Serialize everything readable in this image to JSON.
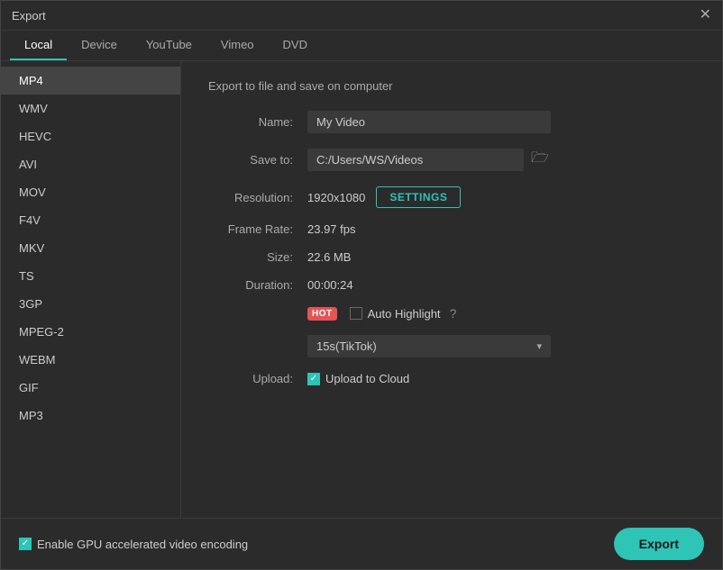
{
  "window": {
    "title": "Export"
  },
  "tabs": [
    {
      "label": "Local",
      "active": true
    },
    {
      "label": "Device",
      "active": false
    },
    {
      "label": "YouTube",
      "active": false
    },
    {
      "label": "Vimeo",
      "active": false
    },
    {
      "label": "DVD",
      "active": false
    }
  ],
  "sidebar": {
    "items": [
      {
        "label": "MP4",
        "active": true
      },
      {
        "label": "WMV",
        "active": false
      },
      {
        "label": "HEVC",
        "active": false
      },
      {
        "label": "AVI",
        "active": false
      },
      {
        "label": "MOV",
        "active": false
      },
      {
        "label": "F4V",
        "active": false
      },
      {
        "label": "MKV",
        "active": false
      },
      {
        "label": "TS",
        "active": false
      },
      {
        "label": "3GP",
        "active": false
      },
      {
        "label": "MPEG-2",
        "active": false
      },
      {
        "label": "WEBM",
        "active": false
      },
      {
        "label": "GIF",
        "active": false
      },
      {
        "label": "MP3",
        "active": false
      }
    ]
  },
  "form": {
    "desc": "Export to file and save on computer",
    "name_label": "Name:",
    "name_value": "My Video",
    "name_placeholder": "My Video",
    "save_label": "Save to:",
    "save_path": "C:/Users/WS/Videos",
    "resolution_label": "Resolution:",
    "resolution_value": "1920x1080",
    "settings_btn": "SETTINGS",
    "framerate_label": "Frame Rate:",
    "framerate_value": "23.97 fps",
    "size_label": "Size:",
    "size_value": "22.6 MB",
    "duration_label": "Duration:",
    "duration_value": "00:00:24",
    "hot_badge": "HOT",
    "auto_highlight_label": "Auto Highlight",
    "dropdown_value": "15s(TikTok)",
    "upload_label": "Upload:",
    "upload_cloud_label": "Upload to Cloud"
  },
  "footer": {
    "gpu_label": "Enable GPU accelerated video encoding",
    "export_btn": "Export"
  }
}
